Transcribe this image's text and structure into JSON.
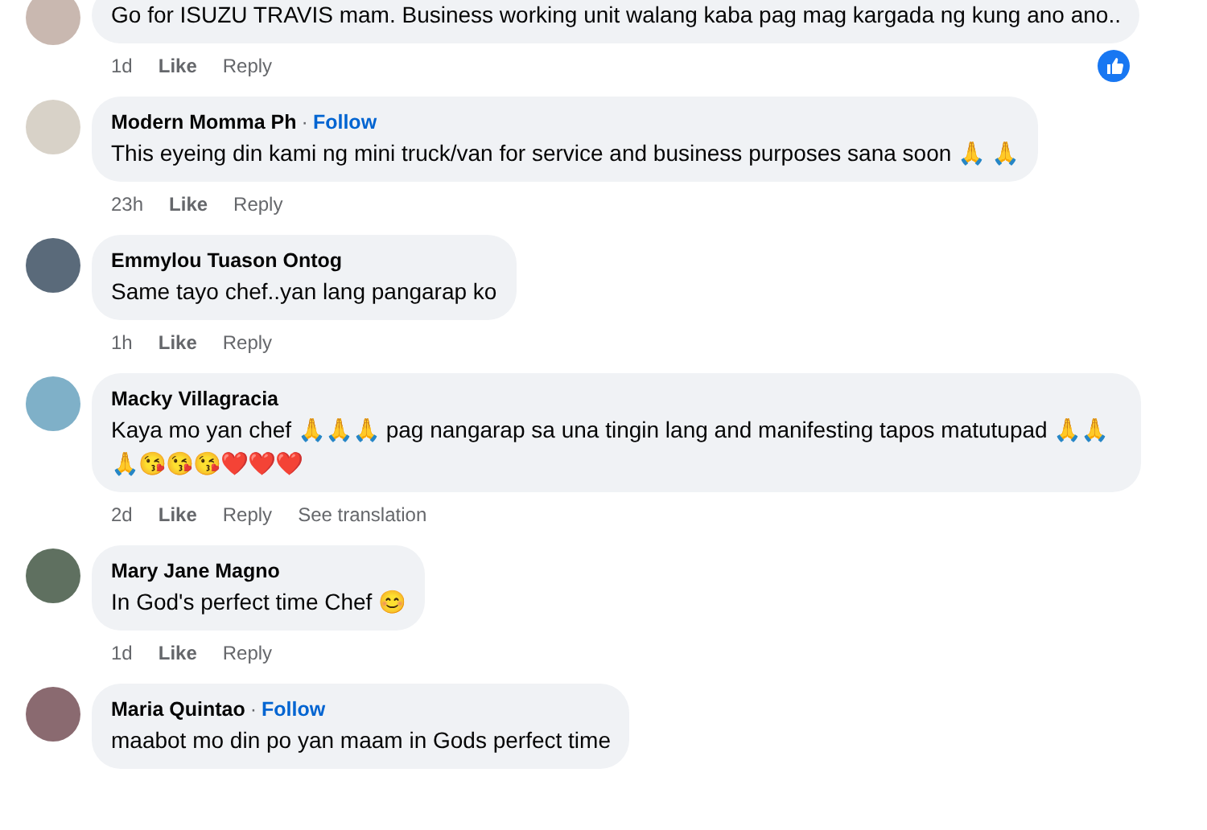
{
  "comments": [
    {
      "text": "Go for ISUZU TRAVIS mam. Business working unit walang kaba pag mag kargada ng kung ano ano..",
      "time": "1d",
      "actions": [
        "Like",
        "Reply"
      ],
      "reaction": true
    },
    {
      "name": "Modern Momma Ph",
      "separator": "·",
      "follow_label": "Follow",
      "text": "This eyeing din kami ng mini truck/van for service and business purposes sana soon 🙏 🙏",
      "time": "23h",
      "actions": [
        "Like",
        "Reply"
      ]
    },
    {
      "name": "Emmylou Tuason Ontog",
      "text": "Same tayo chef..yan lang pangarap ko",
      "time": "1h",
      "actions": [
        "Like",
        "Reply"
      ]
    },
    {
      "name": "Macky Villagracia",
      "text": "Kaya mo yan chef 🙏🙏🙏 pag nangarap sa una tingin lang and manifesting tapos matutupad 🙏🙏🙏😘😘😘❤️❤️❤️",
      "time": "2d",
      "actions": [
        "Like",
        "Reply",
        "See translation"
      ]
    },
    {
      "name": "Mary Jane Magno",
      "text": "In God's perfect time Chef 😊",
      "time": "1d",
      "actions": [
        "Like",
        "Reply"
      ]
    },
    {
      "name": "Maria Quintao",
      "separator": "·",
      "follow_label": "Follow",
      "text": "maabot mo din po yan maam in Gods perfect time"
    }
  ]
}
